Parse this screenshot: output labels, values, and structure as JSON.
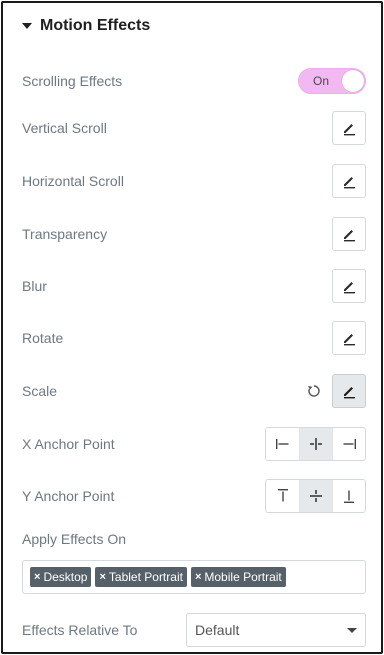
{
  "section": {
    "title": "Motion Effects"
  },
  "scrolling_effects": {
    "label": "Scrolling Effects",
    "toggle_text": "On",
    "toggle_color": "#f2b8f2"
  },
  "effects": [
    {
      "label": "Vertical Scroll"
    },
    {
      "label": "Horizontal Scroll"
    },
    {
      "label": "Transparency"
    },
    {
      "label": "Blur"
    },
    {
      "label": "Rotate"
    },
    {
      "label": "Scale"
    }
  ],
  "x_anchor": {
    "label": "X Anchor Point",
    "options": [
      "left-align-icon",
      "center-align-icon",
      "right-align-icon"
    ],
    "selected": 1
  },
  "y_anchor": {
    "label": "Y Anchor Point",
    "options": [
      "top-align-icon",
      "middle-align-icon",
      "bottom-align-icon"
    ],
    "selected": 1
  },
  "apply_on": {
    "label": "Apply Effects On",
    "tags": [
      "Desktop",
      "Tablet Portrait",
      "Mobile Portrait"
    ]
  },
  "relative_to": {
    "label": "Effects Relative To",
    "value": "Default"
  }
}
